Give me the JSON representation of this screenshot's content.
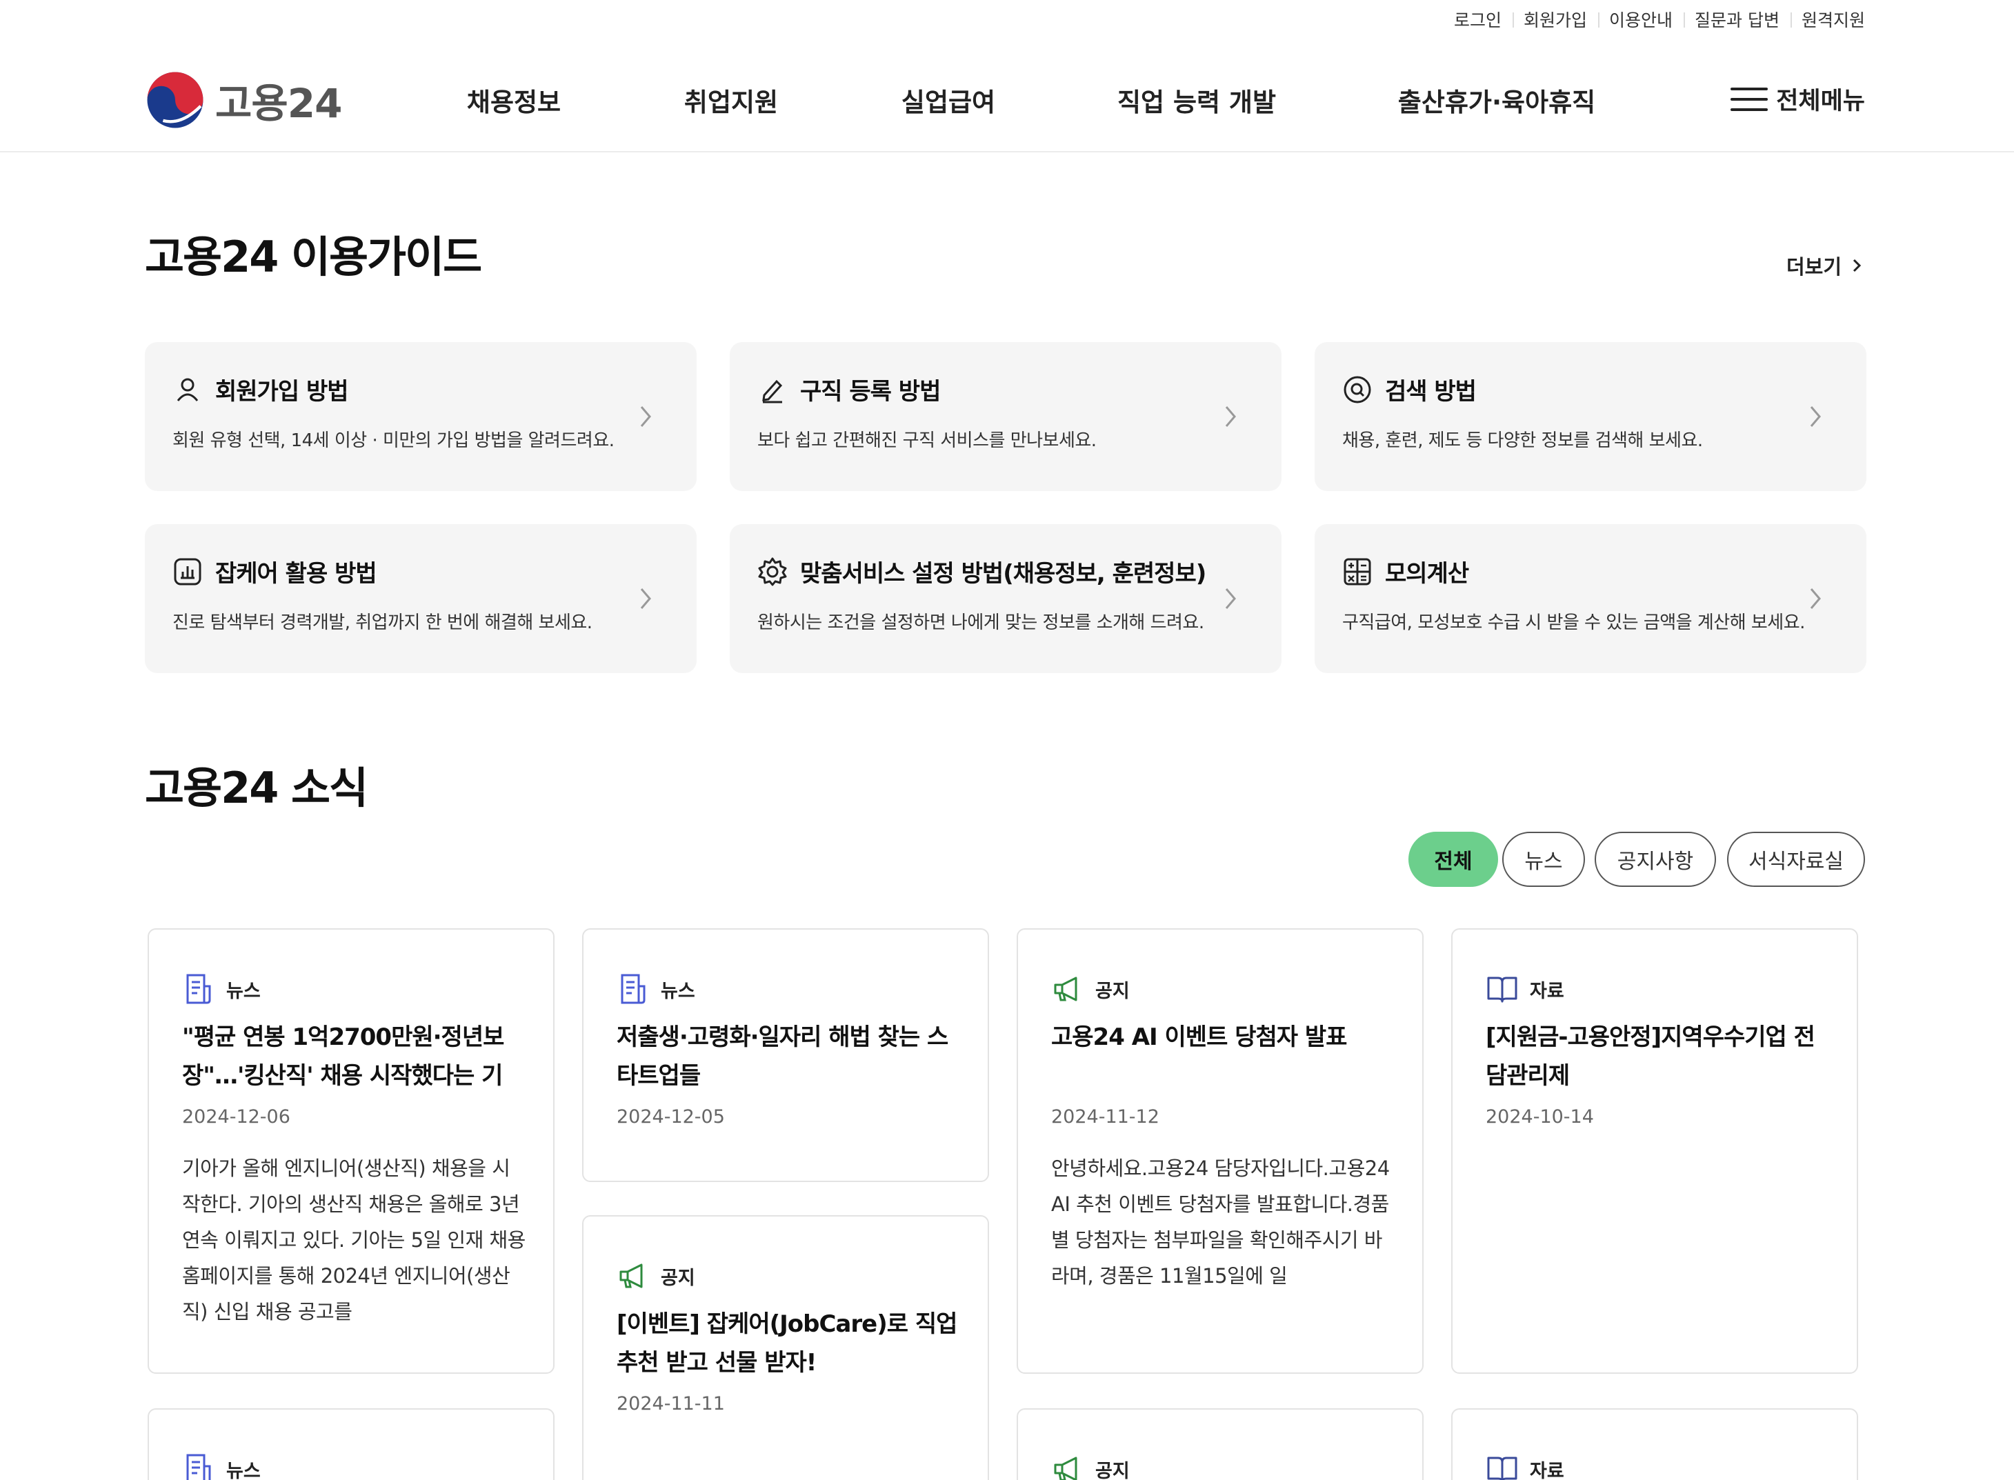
{
  "util_links": [
    "로그인",
    "회원가입",
    "이용안내",
    "질문과 답변",
    "원격지원"
  ],
  "logo": {
    "text": "고용24"
  },
  "gnb": [
    "채용정보",
    "취업지원",
    "실업급여",
    "직업 능력 개발",
    "출산휴가·육아휴직"
  ],
  "allmenu": {
    "label": "전체메뉴"
  },
  "guide": {
    "title": "고용24 이용가이드",
    "more": "더보기",
    "cards": [
      {
        "icon": "user-icon",
        "title": "회원가입 방법",
        "desc": "회원 유형 선택, 14세 이상 · 미만의 가입 방법을 알려드려요."
      },
      {
        "icon": "pencil-icon",
        "title": "구직 등록 방법",
        "desc": "보다 쉽고 간편해진 구직 서비스를 만나보세요."
      },
      {
        "icon": "search-icon",
        "title": "검색 방법",
        "desc": "채용, 훈련, 제도 등 다양한 정보를 검색해 보세요."
      },
      {
        "icon": "chart-icon",
        "title": "잡케어 활용 방법",
        "desc": "진로 탐색부터 경력개발, 취업까지 한 번에 해결해 보세요."
      },
      {
        "icon": "gear-icon",
        "title": "맞춤서비스 설정 방법(채용정보, 훈련정보)",
        "desc": "원하시는 조건을 설정하면 나에게 맞는 정보를 소개해 드려요."
      },
      {
        "icon": "calculator-icon",
        "title": "모의계산",
        "desc": "구직급여, 모성보호 수급 시 받을 수 있는 금액을 계산해 보세요."
      }
    ]
  },
  "news": {
    "title": "고용24 소식",
    "filters": [
      {
        "label": "전체",
        "active": true
      },
      {
        "label": "뉴스",
        "active": false
      },
      {
        "label": "공지사항",
        "active": false
      },
      {
        "label": "서식자료실",
        "active": false
      }
    ],
    "cards": [
      {
        "type": "news",
        "category": "뉴스",
        "title": "\"평균 연봉 1억2700만원·정년보장\"…'킹산직' 채용 시작했다는 기",
        "date": "2024-12-06",
        "body": "기아가 올해 엔지니어(생산직) 채용을 시작한다. 기아의 생산직 채용은 올해로 3년 연속 이뤄지고 있다. 기아는 5일 인재 채용 홈페이지를 통해 2024년 엔지니어(생산직) 신입 채용 공고를"
      },
      {
        "type": "news",
        "category": "뉴스",
        "title": "저출생·고령화·일자리 해법 찾는 스타트업들",
        "date": "2024-12-05",
        "body": ""
      },
      {
        "type": "notice",
        "category": "공지",
        "title": "[이벤트] 잡케어(JobCare)로 직업 추천 받고 선물 받자!",
        "date": "2024-11-11",
        "body": ""
      },
      {
        "type": "notice",
        "category": "공지",
        "title": "고용24 AI 이벤트 당첨자 발표",
        "date": "2024-11-12",
        "body": "안녕하세요.고용24 담당자입니다.고용24 AI 추천 이벤트 당첨자를 발표합니다.경품별 당첨자는 첨부파일을 확인해주시기 바라며, 경품은 11월15일에 일"
      },
      {
        "type": "resource",
        "category": "자료",
        "title": "[지원금-고용안정]지역우수기업 전담관리제",
        "date": "2024-10-14",
        "body": ""
      },
      {
        "type": "news",
        "category": "뉴스",
        "title": "",
        "date": "",
        "body": ""
      },
      {
        "type": "notice",
        "category": "공지",
        "title": "",
        "date": "",
        "body": ""
      },
      {
        "type": "resource",
        "category": "자료",
        "title": "",
        "date": "",
        "body": ""
      }
    ]
  },
  "colors": {
    "accent_green": "#6ccf8c",
    "news_icon": "#4a5bd4",
    "notice_icon": "#2e8b3e",
    "resource_icon": "#3a4a9a"
  }
}
